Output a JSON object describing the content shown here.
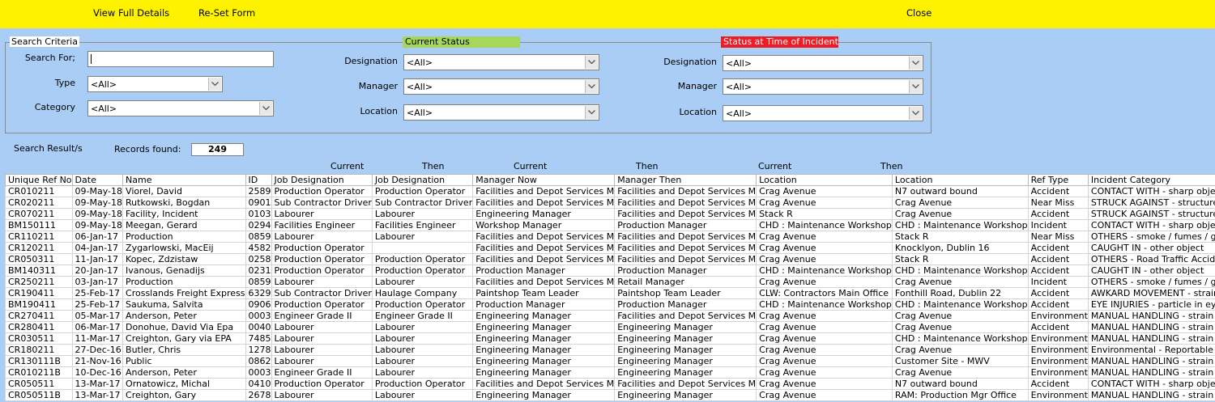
{
  "toolbar": {
    "view_full_details": "View Full Details",
    "reset_form": "Re-Set Form",
    "close": "Close"
  },
  "search": {
    "legend": "Search Criteria",
    "search_for_label": "Search For;",
    "search_for_value": "",
    "type_label": "Type",
    "type_value": "<All>",
    "category_label": "Category",
    "category_value": "<All>"
  },
  "current_status": {
    "title": "Current Status",
    "designation_label": "Designation",
    "designation_value": "<All>",
    "manager_label": "Manager",
    "manager_value": "<All>",
    "location_label": "Location",
    "location_value": "<All>"
  },
  "incident_status": {
    "title": "Status at Time of Incident",
    "designation_label": "Designation",
    "designation_value": "<All>",
    "manager_label": "Manager",
    "manager_value": "<All>",
    "location_label": "Location",
    "location_value": "<All>"
  },
  "results": {
    "label": "Search Result/s",
    "records_label": "Records found:",
    "records_count": "249",
    "group_headers": [
      "Current",
      "Then",
      "Current",
      "Then",
      "Current",
      "Then"
    ],
    "columns": [
      "Unique Ref No",
      "Date",
      "Name",
      "ID",
      "Job Designation",
      "Job Designation",
      "Manager Now",
      "Manager Then",
      "Location",
      "Location",
      "Ref Type",
      "Incident Category"
    ],
    "rows": [
      [
        "CR010211",
        "09-May-18",
        "Viorel, David",
        "2589",
        "Production Operator",
        "Production Operator",
        "Facilities and Depot Services M",
        "Facilities and Depot Services M",
        "Crag Avenue",
        "N7 outward bound",
        "Accident",
        "CONTACT WITH - sharp object"
      ],
      [
        "CR020211",
        "09-May-18",
        "Rutkowski, Bogdan",
        "0901",
        "Sub Contractor Driver",
        "Sub Contractor Driver",
        "Facilities and Depot Services M",
        "Facilities and Depot Services M",
        "Crag Avenue",
        "Crag Avenue",
        "Near Miss",
        "STRUCK AGAINST - structures/equipme"
      ],
      [
        "CR070211",
        "09-May-18",
        "Facility, Incident",
        "0103",
        "Labourer",
        "Labourer",
        "Engineering Manager",
        "Facilities and Depot Services M",
        "Stack R",
        "Crag Avenue",
        "Accident",
        "STRUCK AGAINST - structures/equipme"
      ],
      [
        "BM150111",
        "09-May-18",
        "Meegan, Gerard",
        "0294",
        "Facilities Engineer",
        "Facilities Engineer",
        "Workshop Manager",
        "Production Manager",
        "CHD : Maintenance Workshop",
        "CHD : Maintenance Workshop",
        "Incident",
        "CONTACT WITH - sharp object"
      ],
      [
        "CR110211",
        "06-Jan-17",
        "Production",
        "0859",
        "Labourer",
        "Labourer",
        "Facilities and Depot Services M",
        "Facilities and Depot Services M",
        "Crag Avenue",
        "Stack R",
        "Near Miss",
        "OTHERS - smoke / fumes / gas inhalatio"
      ],
      [
        "CR120211",
        "04-Jan-17",
        "Zygarlowski, MacEij",
        "4582",
        "Production Operator",
        "",
        "Facilities and Depot Services M",
        "Facilities and Depot Services M",
        "Crag Avenue",
        "Knocklyon, Dublin 16",
        "Accident",
        "CAUGHT IN - other object"
      ],
      [
        "CR050311",
        "11-Jan-17",
        "Kopec, Zdzistaw",
        "0258",
        "Production Operator",
        "Production Operator",
        "Facilities and Depot Services M",
        "Facilities and Depot Services M",
        "Crag Avenue",
        "Stack R",
        "Accident",
        "OTHERS - Road Traffic Accident"
      ],
      [
        "BM140311",
        "20-Jan-17",
        "Ivanous, Genadijs",
        "0231",
        "Production Operator",
        "Production Operator",
        "Production Manager",
        "Production Manager",
        "CHD : Maintenance Workshop",
        "CHD : Maintenance Workshop",
        "Accident",
        "CAUGHT IN - other object"
      ],
      [
        "CR250211",
        "03-Jan-17",
        "Production",
        "0859",
        "Labourer",
        "Labourer",
        "Facilities and Depot Services M",
        "Retail Manager",
        "Crag Avenue",
        "Crag Avenue",
        "Incident",
        "OTHERS - smoke / fumes / gas inhalatio"
      ],
      [
        "CR190411",
        "25-Feb-17",
        "Crosslands Freight Express",
        "6329",
        "Sub Contractor Driver",
        "Haulage Company",
        "Paintshop Team Leader",
        "Paintshop Team Leader",
        "CLW: Contractors Main Office",
        "Fonthill Road, Dublin 22",
        "Accident",
        "AWKARD MOVEMENT - strain / sprain"
      ],
      [
        "BM190411",
        "25-Feb-17",
        "Saukuma, Salvita",
        "0906",
        "Production Operator",
        "Production Operator",
        "Production Manager",
        "Production Manager",
        "CHD : Maintenance Workshop",
        "CHD : Maintenance Workshop",
        "Accident",
        "EYE INJURIES - particle in eye"
      ],
      [
        "CR270411",
        "05-Mar-17",
        "Anderson, Peter",
        "0003",
        "Engineer Grade II",
        "Engineer Grade II",
        "Engineering Manager",
        "Facilities and Depot Services M",
        "Crag Avenue",
        "Crag Avenue",
        "Environment",
        "MANUAL HANDLING - strain / sprain"
      ],
      [
        "CR280411",
        "06-Mar-17",
        "Donohue, David Via Epa",
        "0040",
        "Labourer",
        "Labourer",
        "Engineering Manager",
        "Engineering Manager",
        "Crag Avenue",
        "Crag Avenue",
        "Accident",
        "MANUAL HANDLING - strain / sprain"
      ],
      [
        "CR030511",
        "11-Mar-17",
        "Creighton, Gary via EPA",
        "7485",
        "Labourer",
        "Labourer",
        "Engineering Manager",
        "Engineering Manager",
        "Crag Avenue",
        "CHD : Maintenance Workshop",
        "Environment",
        "MANUAL HANDLING - strain / sprain"
      ],
      [
        "CR180211",
        "27-Dec-16",
        "Butler, Chris",
        "1278",
        "Labourer",
        "Labourer",
        "Engineering Manager",
        "Engineering Manager",
        "Crag Avenue",
        "Crag Avenue",
        "Environment",
        "Environmental - Reportable to Environm"
      ],
      [
        "CR130111B",
        "21-Nov-16",
        "Public",
        "0862",
        "Labourer",
        "Labourer",
        "Engineering Manager",
        "Engineering Manager",
        "Crag Avenue",
        "Customer Site - MWV",
        "Environment",
        "MANUAL HANDLING - strain / sprain"
      ],
      [
        "CR010211B",
        "10-Dec-16",
        "Anderson, Peter",
        "0003",
        "Engineer Grade II",
        "Labourer",
        "Engineering Manager",
        "Engineering Manager",
        "Crag Avenue",
        "Crag Avenue",
        "Environment",
        "MANUAL HANDLING - strain / sprain"
      ],
      [
        "CR050511",
        "13-Mar-17",
        "Ornatowicz, Michal",
        "0410",
        "Production Operator",
        "Production Operator",
        "Facilities and Depot Services M",
        "Facilities and Depot Services M",
        "Crag Avenue",
        "N7 outward bound",
        "Accident",
        "CONTACT WITH - sharp object"
      ],
      [
        "CR050511B",
        "13-Mar-17",
        "Creighton, Gary",
        "2678",
        "Labourer",
        "Labourer",
        "Engineering Manager",
        "Engineering Manager",
        "Crag Avenue",
        "RAM: Production Mgr Office",
        "Environment",
        "MANUAL HANDLING - strain / sprain"
      ]
    ]
  }
}
